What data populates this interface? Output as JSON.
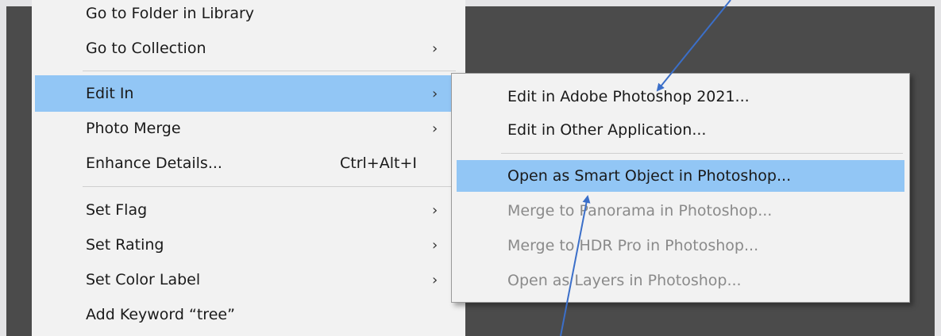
{
  "menu": {
    "items": [
      {
        "label": "Go to Folder in Library",
        "shortcut": "",
        "arrow": ""
      },
      {
        "label": "Go to Collection",
        "shortcut": "",
        "arrow": "›"
      },
      {
        "label": "Edit In",
        "shortcut": "",
        "arrow": "›"
      },
      {
        "label": "Photo Merge",
        "shortcut": "",
        "arrow": "›"
      },
      {
        "label": "Enhance Details...",
        "shortcut": "Ctrl+Alt+I",
        "arrow": ""
      },
      {
        "label": "Set Flag",
        "shortcut": "",
        "arrow": "›"
      },
      {
        "label": "Set Rating",
        "shortcut": "",
        "arrow": "›"
      },
      {
        "label": "Set Color Label",
        "shortcut": "",
        "arrow": "›"
      },
      {
        "label": "Add Keyword “tree”",
        "shortcut": "",
        "arrow": ""
      }
    ]
  },
  "submenu": {
    "items": [
      {
        "label": "Edit in Adobe Photoshop 2021..."
      },
      {
        "label": "Edit in Other Application..."
      },
      {
        "label": "Open as Smart Object in Photoshop..."
      },
      {
        "label": "Merge to Panorama in Photoshop..."
      },
      {
        "label": "Merge to HDR Pro in Photoshop..."
      },
      {
        "label": "Open as Layers in Photoshop..."
      }
    ]
  },
  "colors": {
    "highlight": "#92c6f5",
    "annotation_arrow": "#3b6fc9",
    "disabled_text": "#8a8a8a",
    "workspace_bg": "#4b4b4b"
  }
}
